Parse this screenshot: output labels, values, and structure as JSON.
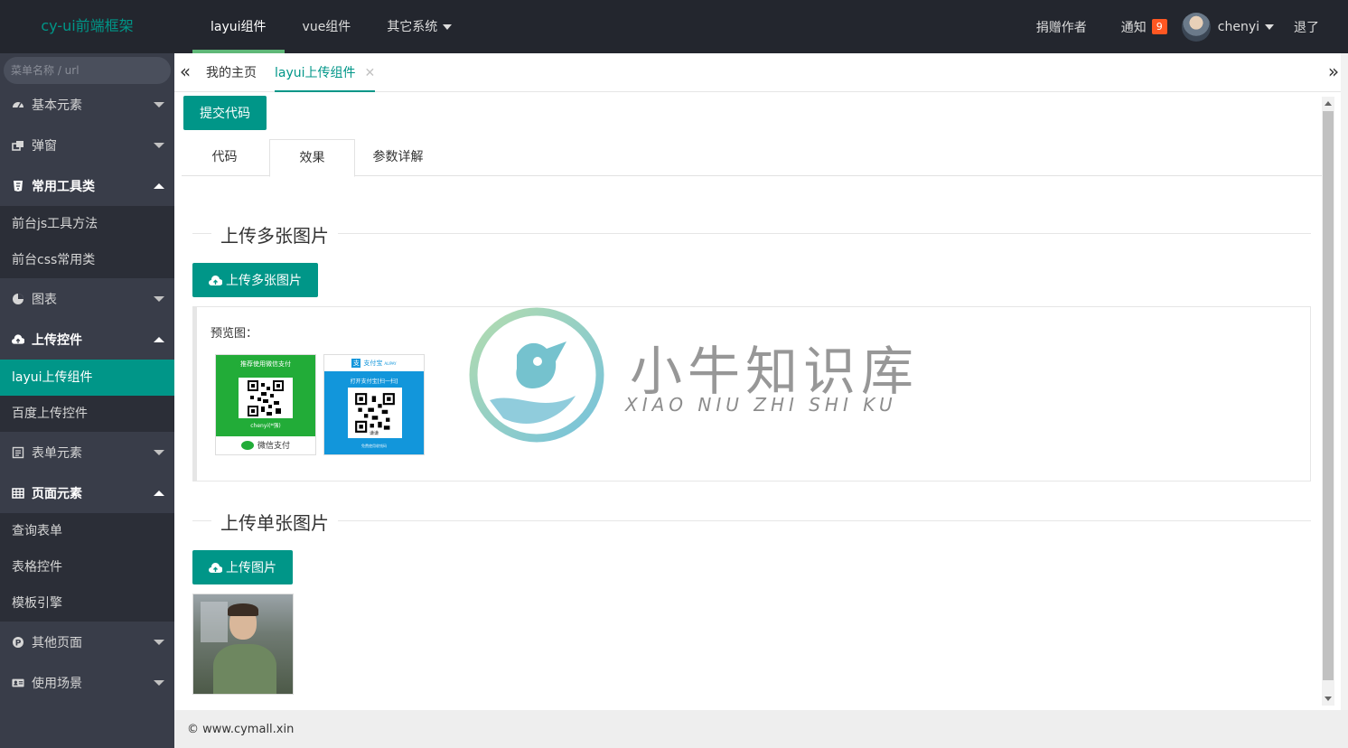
{
  "header": {
    "logo": "cy-ui前端框架",
    "nav": [
      {
        "label": "layui组件",
        "active": true
      },
      {
        "label": "vue组件",
        "active": false
      },
      {
        "label": "其它系统",
        "dropdown": true
      }
    ],
    "donate": "捐赠作者",
    "notice": "通知",
    "notice_count": "9",
    "user": "chenyi",
    "logout": "退了"
  },
  "sidebar": {
    "search_placeholder": "菜单名称 / url",
    "groups": [
      {
        "label": "基本元素",
        "icon": "dashboard-icon",
        "open": false
      },
      {
        "label": "弹窗",
        "icon": "windows-icon",
        "open": false
      },
      {
        "label": "常用工具类",
        "icon": "css3-icon",
        "open": true,
        "children": [
          "前台js工具方法",
          "前台css常用类"
        ]
      },
      {
        "label": "图表",
        "icon": "pie-chart-icon",
        "open": false
      },
      {
        "label": "上传控件",
        "icon": "cloud-upload-icon",
        "open": true,
        "children": [
          "layui上传组件",
          "百度上传控件"
        ],
        "active_child": "layui上传组件"
      },
      {
        "label": "表单元素",
        "icon": "form-icon",
        "open": false
      },
      {
        "label": "页面元素",
        "icon": "table-icon",
        "open": true,
        "children": [
          "查询表单",
          "表格控件",
          "模板引擎"
        ]
      },
      {
        "label": "其他页面",
        "icon": "p-circle-icon",
        "open": false
      },
      {
        "label": "使用场景",
        "icon": "id-card-icon",
        "open": false
      }
    ]
  },
  "page_tabs": [
    {
      "label": "我的主页"
    },
    {
      "label": "layui上传组件",
      "active": true
    }
  ],
  "content": {
    "submit_btn": "提交代码",
    "tabs": [
      "代码",
      "效果",
      "参数详解"
    ],
    "active_tab": "效果",
    "section1_title": "上传多张图片",
    "upload_multi_btn": "上传多张图片",
    "preview_label": "预览图：",
    "qr_wechat": {
      "header": "推荐使用微信支付",
      "name": "chenyi(*强)",
      "footer": "微信支付"
    },
    "qr_alipay": {
      "header": "支付宝",
      "header_en": "ALIPAY",
      "line": "打开支付宝[扫一扫]",
      "name": "谦谦",
      "footer": "免费使用收钱码"
    },
    "section2_title": "上传单张图片",
    "upload_single_btn": "上传图片"
  },
  "watermark": {
    "cn": "小牛知识库",
    "en": "XIAO NIU ZHI SHI KU"
  },
  "footer": "© www.cymall.xin",
  "colors": {
    "accent": "#009688",
    "header": "#23262e",
    "sidebar": "#393d49",
    "badge": "#ff5722"
  }
}
